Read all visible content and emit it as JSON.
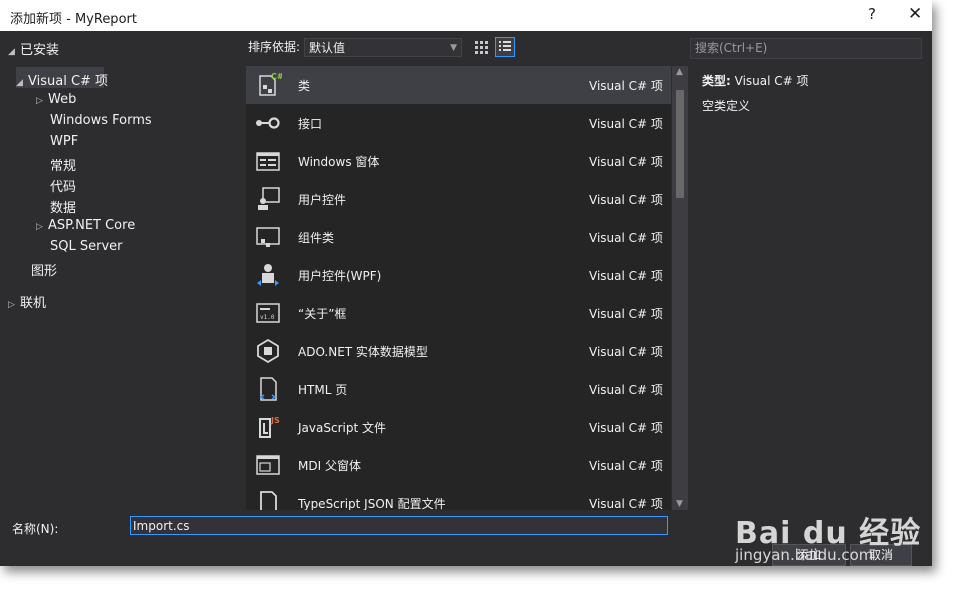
{
  "window": {
    "title": "添加新项 - MyReport",
    "help": "?",
    "close": "✕"
  },
  "sidebar": {
    "installed": "已安装",
    "tree": [
      {
        "label": "Visual C# 项"
      },
      {
        "label": "Web"
      },
      {
        "label": "Windows Forms"
      },
      {
        "label": "WPF"
      },
      {
        "label": "常规"
      },
      {
        "label": "代码"
      },
      {
        "label": "数据"
      },
      {
        "label": "ASP.NET Core"
      },
      {
        "label": "SQL Server"
      },
      {
        "label": "图形"
      }
    ],
    "online": "联机"
  },
  "toolbar": {
    "sort_label": "排序依据:",
    "sort_value": "默认值"
  },
  "search": {
    "placeholder": "搜索(Ctrl+E)"
  },
  "templates": [
    {
      "name": "类",
      "category": "Visual C# 项",
      "icon": "class-icon"
    },
    {
      "name": "接口",
      "category": "Visual C# 项",
      "icon": "interface-icon"
    },
    {
      "name": "Windows 窗体",
      "category": "Visual C# 项",
      "icon": "form-icon"
    },
    {
      "name": "用户控件",
      "category": "Visual C# 项",
      "icon": "user-control-icon"
    },
    {
      "name": "组件类",
      "category": "Visual C# 项",
      "icon": "component-icon"
    },
    {
      "name": "用户控件(WPF)",
      "category": "Visual C# 项",
      "icon": "wpf-user-control-icon"
    },
    {
      "name": "“关于”框",
      "category": "Visual C# 项",
      "icon": "about-box-icon"
    },
    {
      "name": "ADO.NET 实体数据模型",
      "category": "Visual C# 项",
      "icon": "entity-model-icon"
    },
    {
      "name": "HTML 页",
      "category": "Visual C# 项",
      "icon": "html-page-icon"
    },
    {
      "name": "JavaScript 文件",
      "category": "Visual C# 项",
      "icon": "javascript-file-icon"
    },
    {
      "name": "MDI 父窗体",
      "category": "Visual C# 项",
      "icon": "mdi-form-icon"
    },
    {
      "name": "TypeScript JSON 配置文件",
      "category": "Visual C# 项",
      "icon": "json-config-icon"
    }
  ],
  "details": {
    "type_label": "类型:",
    "type_value": "Visual C# 项",
    "description": "空类定义"
  },
  "footer": {
    "name_label": "名称(N):",
    "name_value": "Import.cs",
    "add_label": "添加",
    "cancel_label": "取消"
  },
  "watermark": {
    "brand": "Bai du 经验",
    "url": "jingyan.baidu.com"
  }
}
